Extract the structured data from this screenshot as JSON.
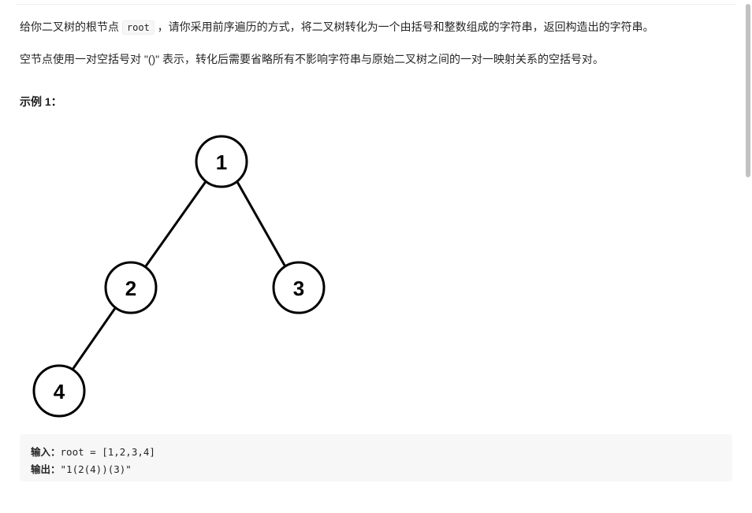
{
  "problem": {
    "p1_a": "给你二叉树的根节点 ",
    "p1_code": "root",
    "p1_b": " ，请你采用前序遍历的方式，将二叉树转化为一个由括号和整数组成的字符串，返回构造出的字符串。",
    "p2_a": "空节点使用一对空括号对 ",
    "p2_quote": "\"()\"",
    "p2_b": " 表示，转化后需要省略所有不影响字符串与原始二叉树之间的一对一映射关系的空括号对。"
  },
  "example": {
    "heading": "示例 1：",
    "tree_nodes": {
      "n1": "1",
      "n2": "2",
      "n3": "3",
      "n4": "4"
    },
    "input_label": "输入：",
    "input_value": "root = [1,2,3,4]",
    "output_label": "输出：",
    "output_value": "\"1(2(4))(3)\""
  }
}
